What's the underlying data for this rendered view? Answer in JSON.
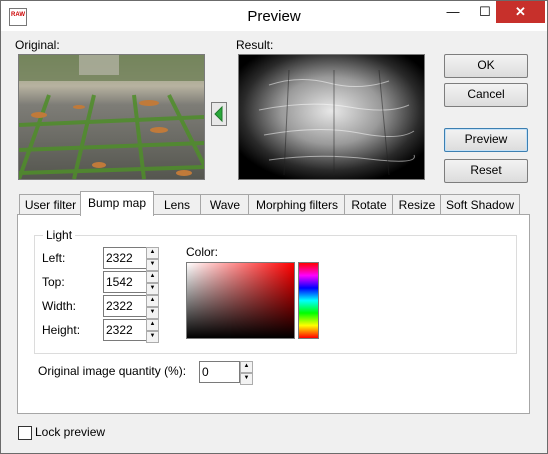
{
  "window": {
    "title": "Preview",
    "minimize": "—",
    "maximize": "☐",
    "close": "✕"
  },
  "original_label": "Original:",
  "result_label": "Result:",
  "buttons": {
    "ok": "OK",
    "cancel": "Cancel",
    "preview": "Preview",
    "reset": "Reset"
  },
  "tabs": [
    "User filter",
    "Bump map",
    "Lens",
    "Wave",
    "Morphing filters",
    "Rotate",
    "Resize",
    "Soft Shadow"
  ],
  "active_tab": "Bump map",
  "light": {
    "group_title": "Light",
    "left_label": "Left:",
    "left_value": "2322",
    "top_label": "Top:",
    "top_value": "1542",
    "width_label": "Width:",
    "width_value": "2322",
    "height_label": "Height:",
    "height_value": "2322",
    "color_label": "Color:"
  },
  "quantity": {
    "label": "Original image quantity (%):",
    "value": "0"
  },
  "lock_preview": "Lock preview",
  "colors": {
    "accent_arrow": "#2aa83a",
    "close_red": "#c7302b"
  }
}
